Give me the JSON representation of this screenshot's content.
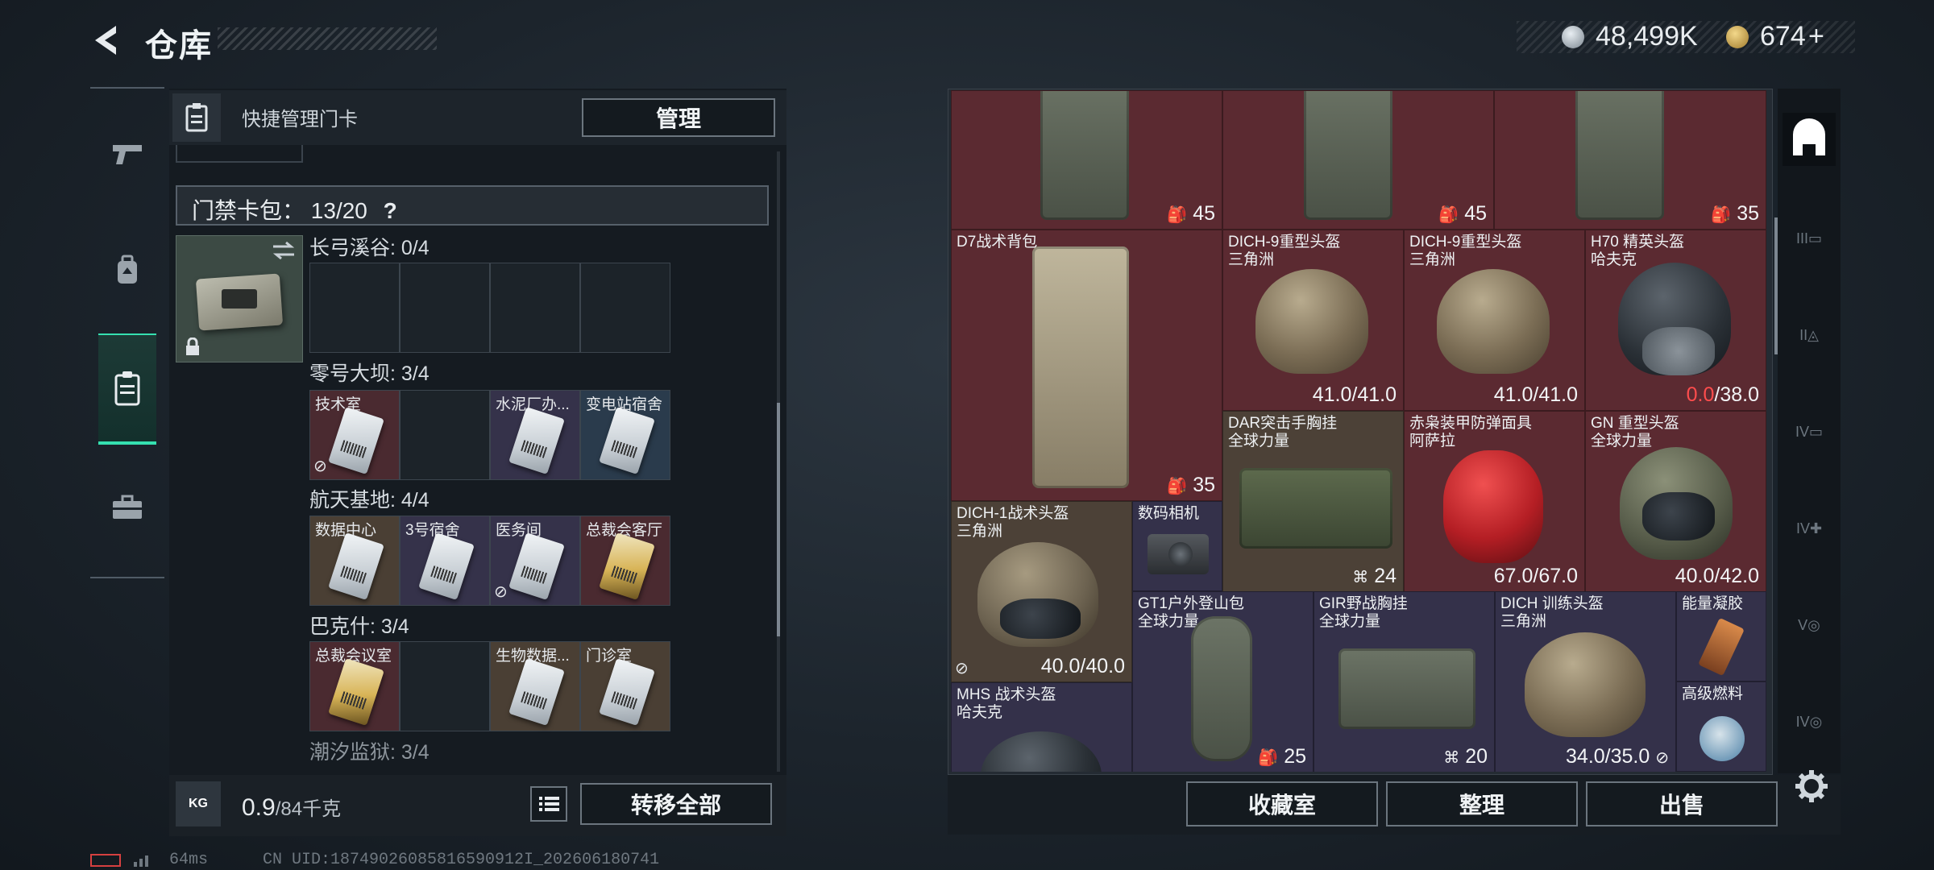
{
  "header": {
    "title": "仓库",
    "currency_silver": "48,499K",
    "currency_gold": "674",
    "currency_gold_plus": "+"
  },
  "quick": {
    "label": "快捷管理门卡",
    "manage_label": "管理"
  },
  "keypack": {
    "label": "门禁卡包：",
    "count": "13/20",
    "help": "?"
  },
  "regions": [
    {
      "name": "长弓溪谷: 0/4",
      "slots": [
        {
          "label": ""
        },
        {
          "label": ""
        },
        {
          "label": ""
        },
        {
          "label": ""
        }
      ]
    },
    {
      "name": "零号大坝: 3/4",
      "slots": [
        {
          "label": "技术室"
        },
        {
          "label": ""
        },
        {
          "label": "水泥厂办..."
        },
        {
          "label": "变电站宿舍"
        }
      ]
    },
    {
      "name": "航天基地: 4/4",
      "slots": [
        {
          "label": "数据中心"
        },
        {
          "label": "3号宿舍"
        },
        {
          "label": "医务间"
        },
        {
          "label": "总裁会客厅"
        }
      ]
    },
    {
      "name": "巴克什: 3/4",
      "slots": [
        {
          "label": "总裁会议室"
        },
        {
          "label": ""
        },
        {
          "label": "生物数据..."
        },
        {
          "label": "门诊室"
        }
      ]
    },
    {
      "name": "潮汐监狱: 3/4"
    }
  ],
  "weight": {
    "kg_label": "KG",
    "value": "0.9",
    "unit": "/84千克"
  },
  "buttons": {
    "transfer_all": "转移全部",
    "collection": "收藏室",
    "organize": "整理",
    "sell": "出售"
  },
  "status": {
    "ping": "64ms",
    "uid": "CN UID:18749026085816590912I_202606180741"
  },
  "inventory": {
    "top_counts": [
      "45",
      "45",
      "35"
    ],
    "items": {
      "d7": {
        "name": "D7战术背包",
        "value": "35"
      },
      "dich9a": {
        "name": "DICH-9重型头盔",
        "sub": "三角洲",
        "value": "41.0/41.0"
      },
      "dich9b": {
        "name": "DICH-9重型头盔",
        "sub": "三角洲",
        "value": "41.0/41.0"
      },
      "h70": {
        "name": "H70 精英头盔",
        "sub": "哈夫克",
        "value_red": "0.0",
        "value": "/38.0"
      },
      "dar": {
        "name": "DAR突击手胸挂",
        "sub": "全球力量",
        "value": "24"
      },
      "chixiao": {
        "name": "赤枭装甲防弹面具",
        "sub": "阿萨拉",
        "value": "67.0/67.0"
      },
      "gn": {
        "name": "GN 重型头盔",
        "sub": "全球力量",
        "value": "40.0/42.0"
      },
      "dich1": {
        "name": "DICH-1战术头盔",
        "sub": "三角洲",
        "value": "40.0/40.0"
      },
      "camera": {
        "name": "数码相机"
      },
      "gt1": {
        "name": "GT1户外登山包",
        "sub": "全球力量",
        "value": "25"
      },
      "gir": {
        "name": "GIR野战胸挂",
        "sub": "全球力量",
        "value": "20"
      },
      "dichtrain": {
        "name": "DICH 训练头盔",
        "sub": "三角洲",
        "value": "34.0/35.0"
      },
      "energy": {
        "name": "能量凝胶"
      },
      "fuel": {
        "name": "高级燃料"
      },
      "mhs": {
        "name": "MHS 战术头盔",
        "sub": "哈夫克"
      }
    }
  },
  "right_tabs": [
    "III",
    "II",
    "IV",
    "IV",
    "V",
    "IV"
  ]
}
